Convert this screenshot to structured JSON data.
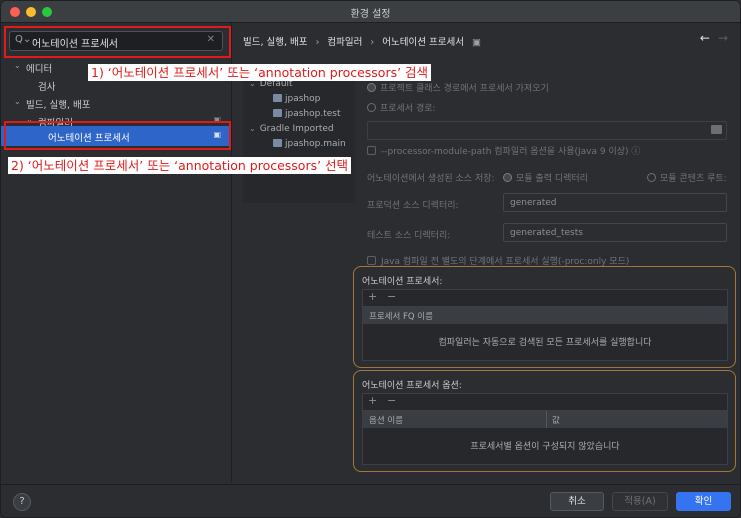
{
  "window": {
    "title": "환경 설정"
  },
  "sidebar": {
    "search_value": "어노테이션 프로세서",
    "items": [
      {
        "label": "에디터"
      },
      {
        "label": "검사"
      },
      {
        "label": "빌드, 실행, 배포"
      },
      {
        "label": "컴파일러"
      },
      {
        "label": "어노테이션 프로세서"
      }
    ]
  },
  "breadcrumb": {
    "part1": "빌드, 실행, 배포",
    "part2": "컴파일러",
    "part3": "어노테이션 프로세서"
  },
  "modules": {
    "items": [
      {
        "label": "Default"
      },
      {
        "label": "jpashop"
      },
      {
        "label": "jpashop.test"
      },
      {
        "label": "Gradle Imported"
      },
      {
        "label": "jpashop.main"
      }
    ]
  },
  "settings": {
    "radio_classpath": "프로젝트 클래스 경로에서 프로세서 가져오기",
    "radio_path": "프로세서 경로:",
    "module_path_option": "--processor-module-path 컴파일러 옵션을 사용(Java 9 이상)",
    "store_sources": "어노테이션에서 생성된 소스 저장:",
    "module_output": "모듈 출력 디렉터리",
    "module_content_root": "모듈 콘텐츠 루트:",
    "production_label": "프로덕션 소스 디렉터리:",
    "production_value": "generated",
    "test_label": "테스트 소스 디렉터리:",
    "test_value": "generated_tests",
    "proc_only": "Java 컴파일 전 별도의 단계에서 프로세서 실행(-proc:only 모드)"
  },
  "processors": {
    "title": "어노테이션 프로세서:",
    "column": "프로세서 FQ 이름",
    "empty": "컴파일러는 자동으로 검색된 모든 프로세서를 실행합니다"
  },
  "options": {
    "title": "어노테이션 프로세서 옵션:",
    "col_name": "옵션 이름",
    "col_value": "값",
    "empty": "프로세서별 옵션이 구성되지 않았습니다"
  },
  "annotations": {
    "step1": "1) ‘어노테이션 프로세서’ 또는 ‘annotation processors’ 검색",
    "step2": "2) ‘어노테이션 프로세서’ 또는 ‘annotation processors’ 선택"
  },
  "footer": {
    "cancel": "취소",
    "apply": "적용(A)",
    "ok": "확인"
  },
  "colors": {
    "accent": "#3574f0",
    "annotation_red": "#e01b1b",
    "group_border": "#a0793a"
  }
}
